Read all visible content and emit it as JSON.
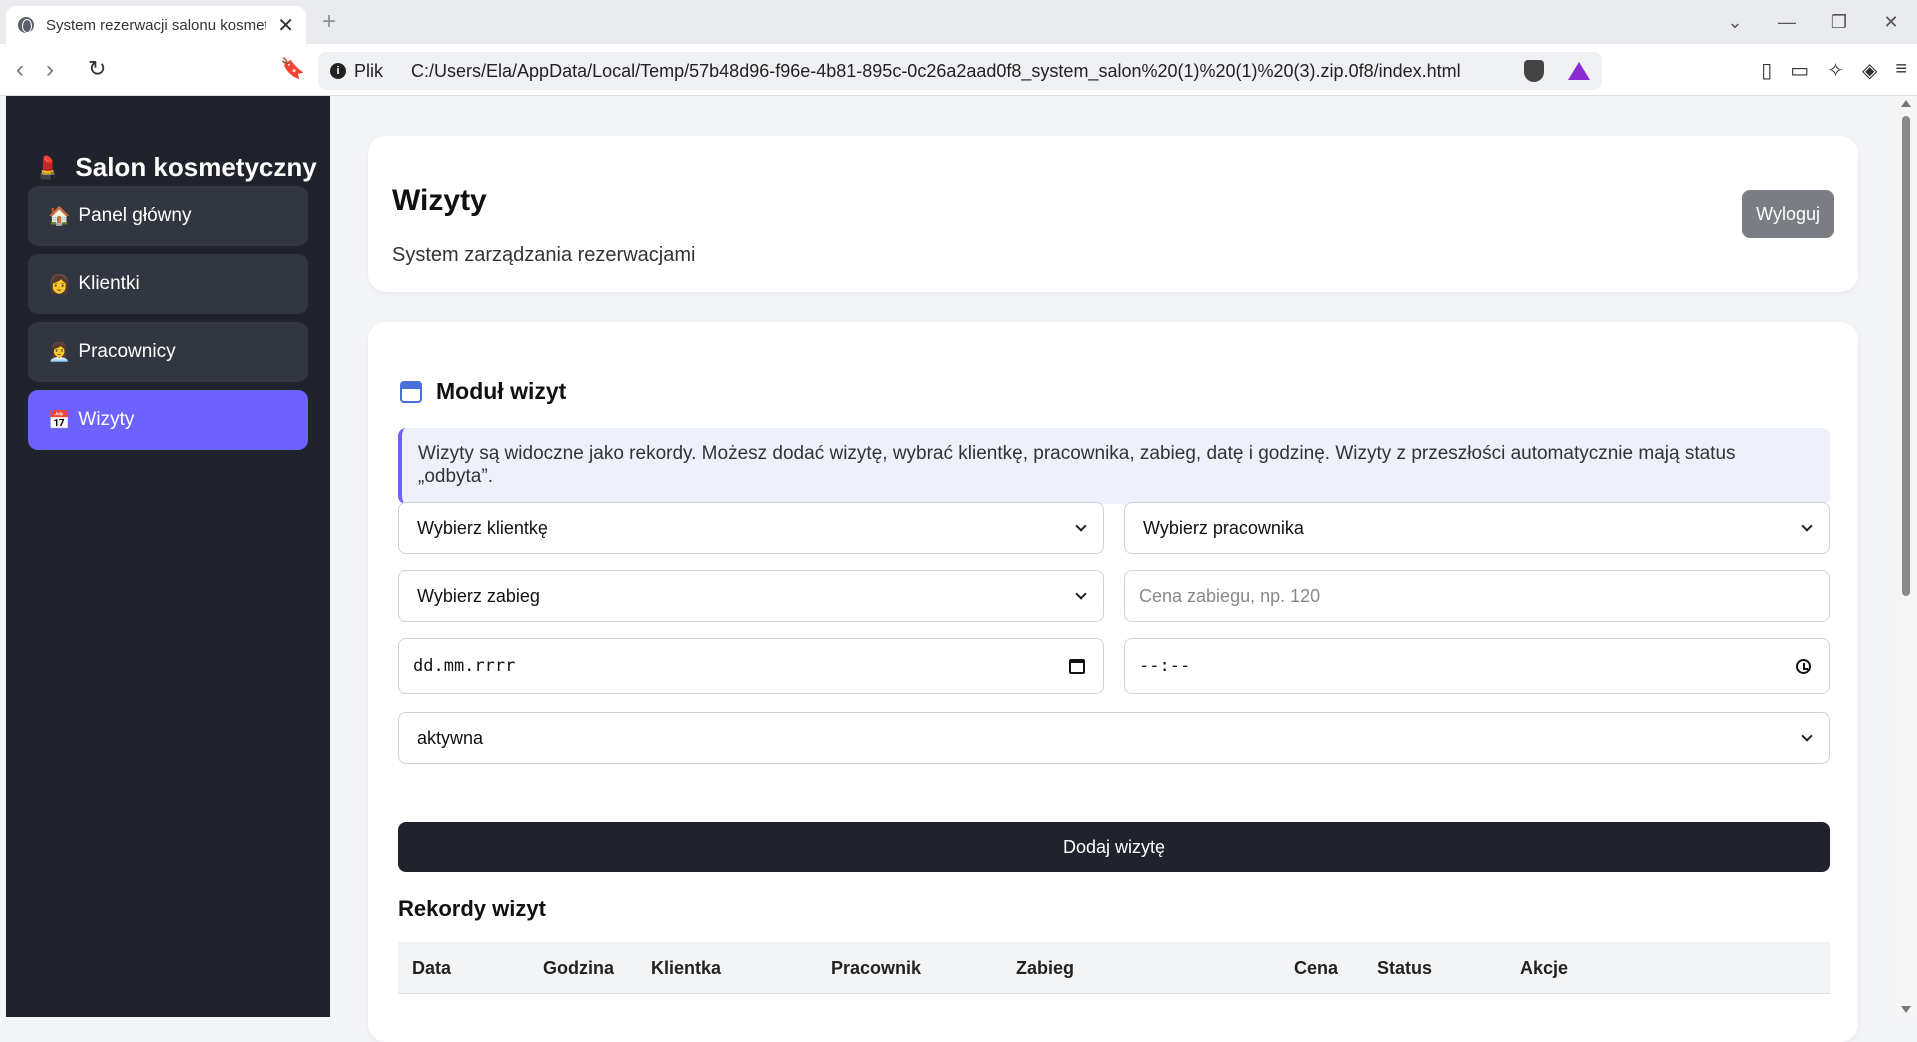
{
  "browser": {
    "tab_title": "System rezerwacji salonu kosmet",
    "tab_close": "✕",
    "new_tab": "+",
    "url_protocol": "Plik",
    "url": "C:/Users/Ela/AppData/Local/Temp/57b48d96-f96e-4b81-895c-0c26a2aad0f8_system_salon%20(1)%20(1)%20(3).zip.0f8/index.html",
    "info_glyph": "i"
  },
  "sidebar": {
    "brand_emoji": "💄",
    "brand": "Salon kosmetyczny",
    "items": [
      {
        "emoji": "🏠",
        "label": "Panel główny",
        "active": false
      },
      {
        "emoji": "👩",
        "label": "Klientki",
        "active": false
      },
      {
        "emoji": "👩‍💼",
        "label": "Pracownicy",
        "active": false
      },
      {
        "emoji": "📅",
        "label": "Wizyty",
        "active": true
      }
    ]
  },
  "header": {
    "title": "Wizyty",
    "subtitle": "System zarządzania rezerwacjami",
    "logout": "Wyloguj"
  },
  "module": {
    "title": "Moduł wizyt",
    "info": "Wizyty są widoczne jako rekordy. Możesz dodać wizytę, wybrać klientkę, pracownika, zabieg, datę i godzinę. Wizyty z przeszłości automatycznie mają status „odbyta”.",
    "client_select": "Wybierz klientkę",
    "employee_select": "Wybierz pracownika",
    "service_select": "Wybierz zabieg",
    "price_placeholder": "Cena zabiegu, np. 120",
    "date_value": "dd.mm.rrrr",
    "time_value": "--:--",
    "status_select": "aktywna",
    "add_button": "Dodaj wizytę",
    "records_title": "Rekordy wizyt",
    "columns": [
      "Data",
      "Godzina",
      "Klientka",
      "Pracownik",
      "Zabieg",
      "Cena",
      "Status",
      "Akcje"
    ]
  },
  "colors": {
    "accent": "#6c63ff",
    "sidebar_bg": "#20232b",
    "logout_bg": "#7a7d83"
  }
}
